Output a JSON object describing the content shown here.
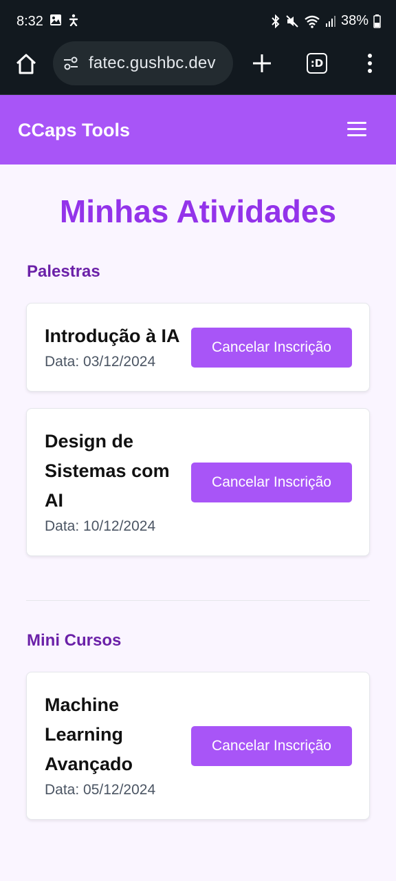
{
  "status_bar": {
    "time": "8:32",
    "battery": "38%"
  },
  "browser": {
    "url": "fatec.gushbc.dev",
    "tabs_label": ":D"
  },
  "header": {
    "brand": "CCaps Tools"
  },
  "page": {
    "title": "Minhas Atividades"
  },
  "sections": [
    {
      "title": "Palestras",
      "items": [
        {
          "title": "Introdução à IA",
          "date": "Data: 03/12/2024",
          "button": "Cancelar Inscrição"
        },
        {
          "title": "Design de Sistemas com AI",
          "date": "Data: 10/12/2024",
          "button": "Cancelar Inscrição"
        }
      ]
    },
    {
      "title": "Mini Cursos",
      "items": [
        {
          "title": "Machine Learning Avançado",
          "date": "Data: 05/12/2024",
          "button": "Cancelar Inscrição"
        }
      ]
    }
  ],
  "colors": {
    "accent": "#a855f7",
    "title": "#9333ea",
    "section": "#6b21a8",
    "background": "#faf5ff"
  }
}
